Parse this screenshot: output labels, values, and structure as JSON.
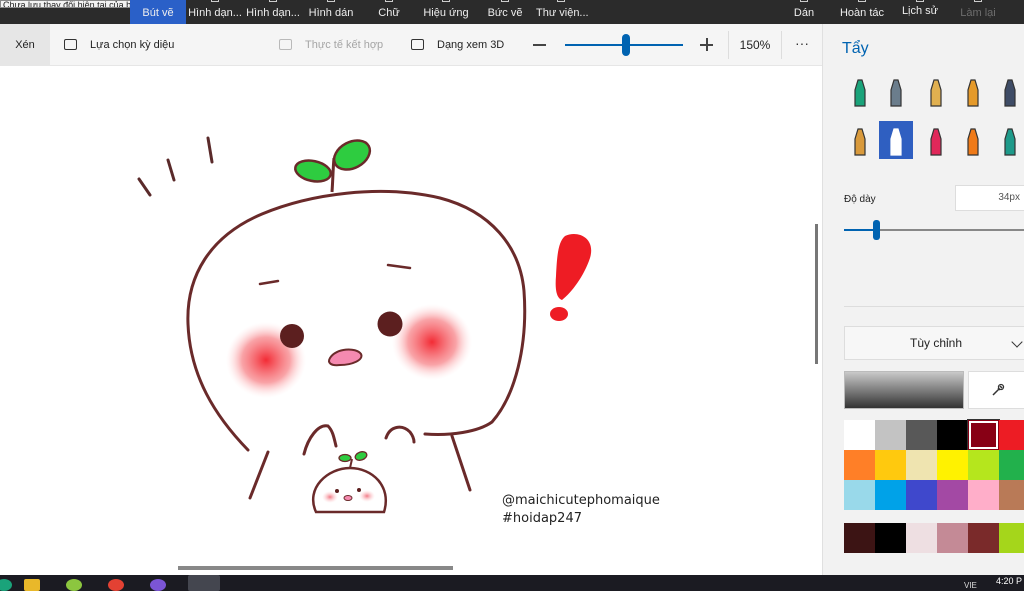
{
  "title_bar": {
    "tooltip": "Chưa lưu thay đổi hiện tại của bạn..."
  },
  "ribbon": {
    "items": [
      {
        "label": "Bút vẽ",
        "active": true
      },
      {
        "label": "Hình dạn...",
        "active": false
      },
      {
        "label": "Hình dạn...",
        "active": false
      },
      {
        "label": "Hình dán",
        "active": false
      },
      {
        "label": "Chữ",
        "active": false
      },
      {
        "label": "Hiệu ứng",
        "active": false
      },
      {
        "label": "Bức vẽ",
        "active": false
      },
      {
        "label": "Thư viện...",
        "active": false
      },
      {
        "label": "Dán",
        "active": false
      },
      {
        "label": "Hoàn tác",
        "active": false
      },
      {
        "label": "Lịch sử",
        "active": false
      },
      {
        "label": "Làm lại",
        "active": false
      }
    ]
  },
  "toolbar": {
    "crop": "Xén",
    "magic_select": "Lựa chọn kỳ diệu",
    "mixed_reality": "Thực tế kết hợp",
    "view_3d": "Dạng xem 3D",
    "zoom_value": "150%",
    "more": "···"
  },
  "canvas": {
    "watermark_line1": "@maichicutephomaique",
    "watermark_line2": "#hoidap247"
  },
  "panel": {
    "title": "Tẩy",
    "thickness_label": "Độ dày",
    "thickness_value": "34px",
    "thickness_level": 0.18,
    "dropdown_label": "Tùy chỉnh",
    "brushes": [
      {
        "name": "marker-brush-icon",
        "color": "#1aa37a"
      },
      {
        "name": "calligraphy-pen-brush-icon",
        "color": "#6b7d8c"
      },
      {
        "name": "oil-brush-icon",
        "color": "#e0b050"
      },
      {
        "name": "watercolor-brush-icon",
        "color": "#e59a2a"
      },
      {
        "name": "pixel-pen-brush-icon",
        "color": "#3e4c66"
      },
      {
        "name": "pencil-brush-icon",
        "color": "#d99a3c"
      },
      {
        "name": "eraser-brush-icon",
        "color": "#ffffff",
        "selected": true
      },
      {
        "name": "crayon-brush-icon",
        "color": "#e0285a"
      },
      {
        "name": "spray-can-brush-icon",
        "color": "#ef7a18"
      },
      {
        "name": "fill-bucket-brush-icon",
        "color": "#1e9a8a"
      }
    ],
    "palette": [
      "#ffffff",
      "#c3c3c3",
      "#585858",
      "#000000",
      "#880015",
      "#ed1c24",
      "#ff7f27",
      "#ffc90e",
      "#efe4b0",
      "#fff200",
      "#b5e61d",
      "#22b14c",
      "#99d9ea",
      "#00a2e8",
      "#3f48cc",
      "#a349a4",
      "#ffaec9",
      "#b97a57"
    ],
    "selected_color": "#880015",
    "custom_palette": [
      "#3c1414",
      "#000000",
      "#eedfe2",
      "#c48a96",
      "#7a2a2a",
      "#a5d61b"
    ]
  },
  "taskbar": {
    "language": "VIE",
    "time": "4:20 P"
  }
}
